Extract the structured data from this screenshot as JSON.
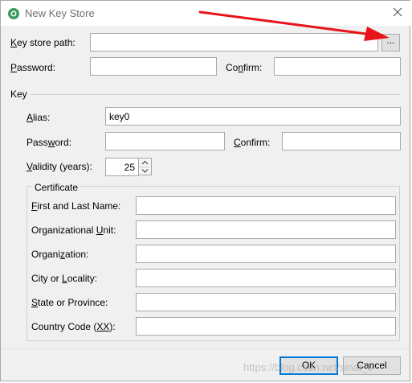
{
  "window": {
    "title": "New Key Store",
    "icon": "android-studio-icon",
    "close_icon": "close-icon"
  },
  "keystore": {
    "path_label_mn": "K",
    "path_label_rest": "ey store path:",
    "path_value": "",
    "browse_label": "...",
    "password_label_mn": "P",
    "password_label_rest": "assword:",
    "password_value": "",
    "confirm_label_pre": "Co",
    "confirm_label_mn": "n",
    "confirm_label_rest": "firm:",
    "confirm_value": ""
  },
  "key": {
    "section_label": "Key",
    "alias_label_mn": "A",
    "alias_label_rest": "lias:",
    "alias_value": "key0",
    "password_label_pre": "Pass",
    "password_label_mn": "w",
    "password_label_rest": "ord:",
    "password_value": "",
    "confirm_label_mn": "C",
    "confirm_label_rest": "onfirm:",
    "confirm_value": "",
    "validity_label_mn": "V",
    "validity_label_rest": "alidity (years):",
    "validity_value": "25"
  },
  "certificate": {
    "group_label": "Certificate",
    "fields": [
      {
        "pre": "",
        "mn": "F",
        "rest": "irst and Last Name:",
        "value": ""
      },
      {
        "pre": "Organizational ",
        "mn": "U",
        "rest": "nit:",
        "value": ""
      },
      {
        "pre": "Organi",
        "mn": "z",
        "rest": "ation:",
        "value": ""
      },
      {
        "pre": "City or ",
        "mn": "L",
        "rest": "ocality:",
        "value": ""
      },
      {
        "pre": "",
        "mn": "S",
        "rest": "tate or Province:",
        "value": ""
      },
      {
        "pre": "Country Code (",
        "mn": "XX",
        "rest": "):",
        "value": ""
      }
    ]
  },
  "buttons": {
    "ok_label": "OK",
    "cancel_label": "Cancel"
  },
  "watermark": "https://blog.csdn.net/sinat_0",
  "colors": {
    "arrow": "#e8141b",
    "dialog_bg": "#f0f0f0",
    "focus_border": "#0078d7"
  }
}
